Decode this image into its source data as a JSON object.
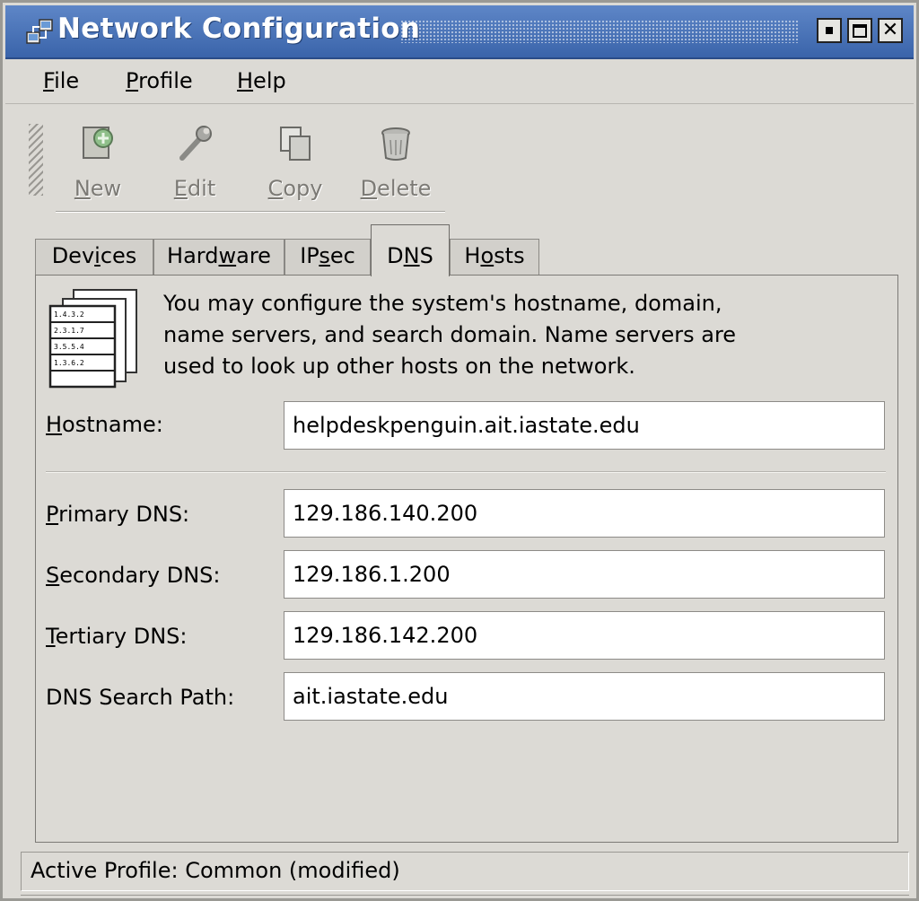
{
  "window": {
    "title": "Network Configuration",
    "controls": [
      "minimize",
      "maximize",
      "close"
    ]
  },
  "menu": {
    "file": {
      "mnemonic": "F",
      "rest": "ile"
    },
    "profile": {
      "mnemonic": "P",
      "rest": "rofile"
    },
    "help": {
      "mnemonic": "H",
      "rest": "elp"
    }
  },
  "toolbar": {
    "new": {
      "icon": "new-device-icon",
      "mnemonic": "N",
      "rest": "ew"
    },
    "edit": {
      "icon": "wrench-icon",
      "mnemonic": "E",
      "rest": "dit"
    },
    "copy": {
      "icon": "copy-icon",
      "mnemonic": "C",
      "rest": "opy"
    },
    "delete": {
      "icon": "trash-icon",
      "mnemonic": "D",
      "rest": "elete"
    }
  },
  "tabs": {
    "devices": {
      "pre": "Dev",
      "mnemonic": "i",
      "post": "ces"
    },
    "hardware": {
      "pre": "Hard",
      "mnemonic": "w",
      "post": "are"
    },
    "ipsec": {
      "pre": "IP",
      "mnemonic": "s",
      "post": "ec"
    },
    "dns": {
      "pre": "D",
      "mnemonic": "N",
      "post": "S"
    },
    "hosts": {
      "pre": "H",
      "mnemonic": "o",
      "post": "sts"
    },
    "active": "DNS"
  },
  "dns_panel": {
    "info_icon": "dns-table-icon",
    "description_lines": [
      "You may configure the system's hostname, domain,",
      "name servers, and search domain. Name servers are",
      "used to look up other hosts on the network."
    ],
    "hostname": {
      "mnemonic": "H",
      "rest": "ostname:",
      "value": "helpdeskpenguin.ait.iastate.edu"
    },
    "primary_dns": {
      "mnemonic": "P",
      "rest": "rimary DNS:",
      "value": "129.186.140.200"
    },
    "secondary_dns": {
      "mnemonic": "S",
      "rest": "econdary DNS:",
      "value": "129.186.1.200"
    },
    "tertiary_dns": {
      "mnemonic": "T",
      "rest": "ertiary DNS:",
      "value": "129.186.142.200"
    },
    "search_path": {
      "label": "DNS Search Path:",
      "value": "ait.iastate.edu"
    }
  },
  "status": {
    "text": "Active Profile: Common (modified)"
  },
  "colors": {
    "titlebar": "#4a73b8",
    "window_bg": "#dcdad5",
    "disabled_text": "#7c7a75"
  }
}
